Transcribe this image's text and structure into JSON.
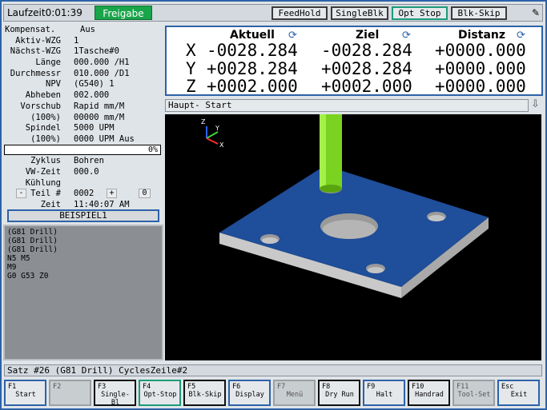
{
  "topbar": {
    "runtime": "Laufzeit0:01:39",
    "freigabe": "Freigabe",
    "buttons": [
      "FeedHold",
      "SingleBlk",
      "Opt Stop",
      "Blk-Skip"
    ],
    "pen_icon": "pen-icon"
  },
  "info": {
    "rows": [
      {
        "label": "Kompensat.",
        "value": "Aus"
      },
      {
        "label": "Aktiv-WZG",
        "value": "1"
      },
      {
        "label": "Nächst-WZG",
        "value": "1Tasche#0"
      },
      {
        "label": "Länge",
        "value": "000.000 /H1"
      },
      {
        "label": "Durchmessr",
        "value": "010.000 /D1"
      },
      {
        "label": "NPV",
        "value": "(G540) 1"
      },
      {
        "label": "Abheben",
        "value": "002.000"
      },
      {
        "label": "Vorschub",
        "value": "Rapid mm/M"
      },
      {
        "label": "(100%)",
        "value": "00000 mm/M"
      },
      {
        "label": "Spindel",
        "value": "5000 UPM"
      },
      {
        "label": "(100%)",
        "value": "0000 UPM Aus"
      }
    ],
    "progress": "0%",
    "rows2": [
      {
        "label": "Zyklus",
        "value": "Bohren"
      },
      {
        "label": "VW-Zeit",
        "value": "000.0"
      },
      {
        "label": "Kühlung",
        "value": ""
      }
    ],
    "teil_minus": "-",
    "teil_label": "Teil #",
    "teil_value": "0002",
    "teil_plus": "+",
    "teil_zero": "0",
    "zeit_label": "Zeit",
    "zeit_value": "11:40:07 AM",
    "program_name": "BEISPIEL1"
  },
  "gcode": [
    "(G81 Drill)",
    "(G81 Drill)",
    "(G81 Drill)",
    "N5 M5",
    "M9",
    "G0 G53 Z0"
  ],
  "dro": {
    "headers": [
      "Aktuell",
      "Ziel",
      "Distanz"
    ],
    "refresh_icon": "⟳",
    "axes": [
      {
        "axis": "X",
        "aktuell": "-0028.284",
        "ziel": "-0028.284",
        "distanz": "+0000.000"
      },
      {
        "axis": "Y",
        "aktuell": "+0028.284",
        "ziel": "+0028.284",
        "distanz": "+0000.000"
      },
      {
        "axis": "Z",
        "aktuell": "+0002.000",
        "ziel": "+0002.000",
        "distanz": "+0000.000"
      }
    ]
  },
  "subbar": {
    "text": "Haupt-  Start",
    "arrow": "⇩"
  },
  "viewport": {
    "axis_z": "Z",
    "axis_y": "Y",
    "axis_x": "X"
  },
  "status": "Satz #26  (G81 Drill)  CyclesZeile#2",
  "fkeys": [
    {
      "key": "F1",
      "label": "Start",
      "style": "blue"
    },
    {
      "key": "F2",
      "label": "",
      "style": "disabled"
    },
    {
      "key": "F3",
      "label": "Single-Bl",
      "style": "dark"
    },
    {
      "key": "F4",
      "label": "Opt-Stop",
      "style": "green"
    },
    {
      "key": "F5",
      "label": "Blk-Skip",
      "style": "dark"
    },
    {
      "key": "F6",
      "label": "Display",
      "style": "blue"
    },
    {
      "key": "F7",
      "label": "Menü",
      "style": "disabled"
    },
    {
      "key": "F8",
      "label": "Dry Run",
      "style": "dark"
    },
    {
      "key": "F9",
      "label": "Halt",
      "style": "blue"
    },
    {
      "key": "F10",
      "label": "Handrad",
      "style": "dark"
    },
    {
      "key": "F11",
      "label": "Tool-Set",
      "style": "disabled"
    },
    {
      "key": "Esc",
      "label": "Exit",
      "style": "blue"
    }
  ],
  "colors": {
    "accent": "#2d62a8",
    "freigabe": "#19a54a",
    "plate": "#1f4e9a",
    "tool": "#7ad320"
  }
}
